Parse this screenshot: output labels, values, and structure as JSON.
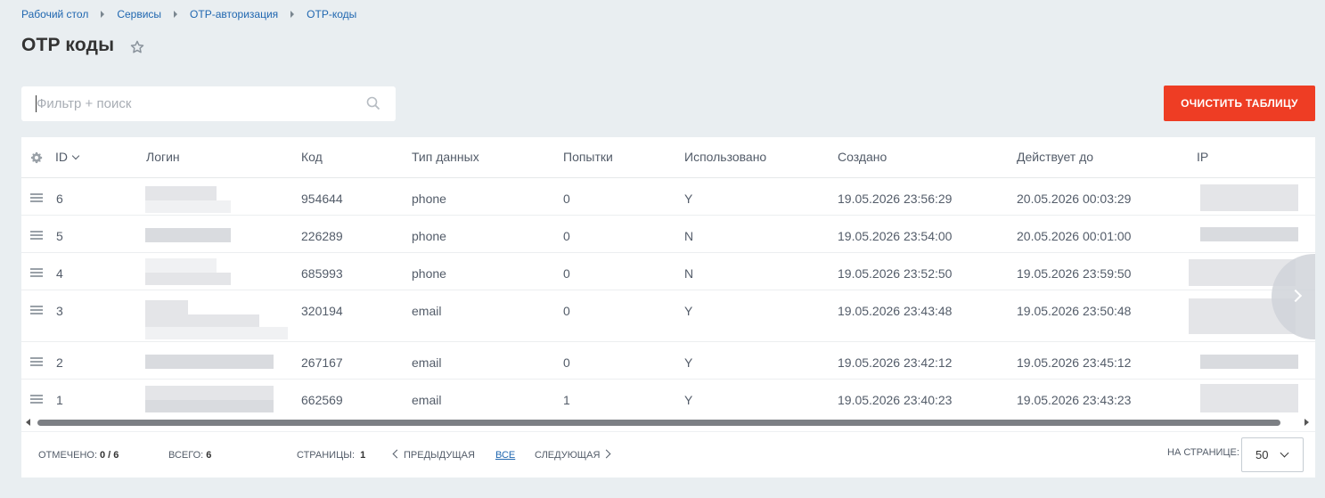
{
  "breadcrumb": [
    "Рабочий стол",
    "Сервисы",
    "OTP-авторизация",
    "OTP-коды"
  ],
  "page": {
    "title": "OTP коды"
  },
  "search": {
    "placeholder": "Фильтр + поиск"
  },
  "toolbar": {
    "clear_label": "ОЧИСТИТЬ ТАБЛИЦУ"
  },
  "grid": {
    "columns": [
      "ID",
      "Логин",
      "Код",
      "Тип данных",
      "Попытки",
      "Использовано",
      "Создано",
      "Действует до",
      "IP"
    ],
    "rows": [
      {
        "id": "6",
        "code": "954644",
        "type": "phone",
        "attempts": "0",
        "used": "Y",
        "created": "19.05.2026 23:56:29",
        "valid_until": "20.05.2026 00:03:29"
      },
      {
        "id": "5",
        "code": "226289",
        "type": "phone",
        "attempts": "0",
        "used": "N",
        "created": "19.05.2026 23:54:00",
        "valid_until": "20.05.2026 00:01:00"
      },
      {
        "id": "4",
        "code": "685993",
        "type": "phone",
        "attempts": "0",
        "used": "N",
        "created": "19.05.2026 23:52:50",
        "valid_until": "19.05.2026 23:59:50"
      },
      {
        "id": "3",
        "code": "320194",
        "type": "email",
        "attempts": "0",
        "used": "Y",
        "created": "19.05.2026 23:43:48",
        "valid_until": "19.05.2026 23:50:48"
      },
      {
        "id": "2",
        "code": "267167",
        "type": "email",
        "attempts": "0",
        "used": "Y",
        "created": "19.05.2026 23:42:12",
        "valid_until": "19.05.2026 23:45:12"
      },
      {
        "id": "1",
        "code": "662569",
        "type": "email",
        "attempts": "1",
        "used": "Y",
        "created": "19.05.2026 23:40:23",
        "valid_until": "19.05.2026 23:43:23"
      }
    ]
  },
  "footer": {
    "checked_label": "Отмечено:",
    "checked_value": "0 / 6",
    "total_label": "Всего:",
    "total_value": "6",
    "pages_label": "Страницы:",
    "pages_value": "1",
    "prev_label": "Предыдущая",
    "all_label": "Все",
    "next_label": "Следующая",
    "per_page_label": "На странице:",
    "per_page_value": "50"
  }
}
